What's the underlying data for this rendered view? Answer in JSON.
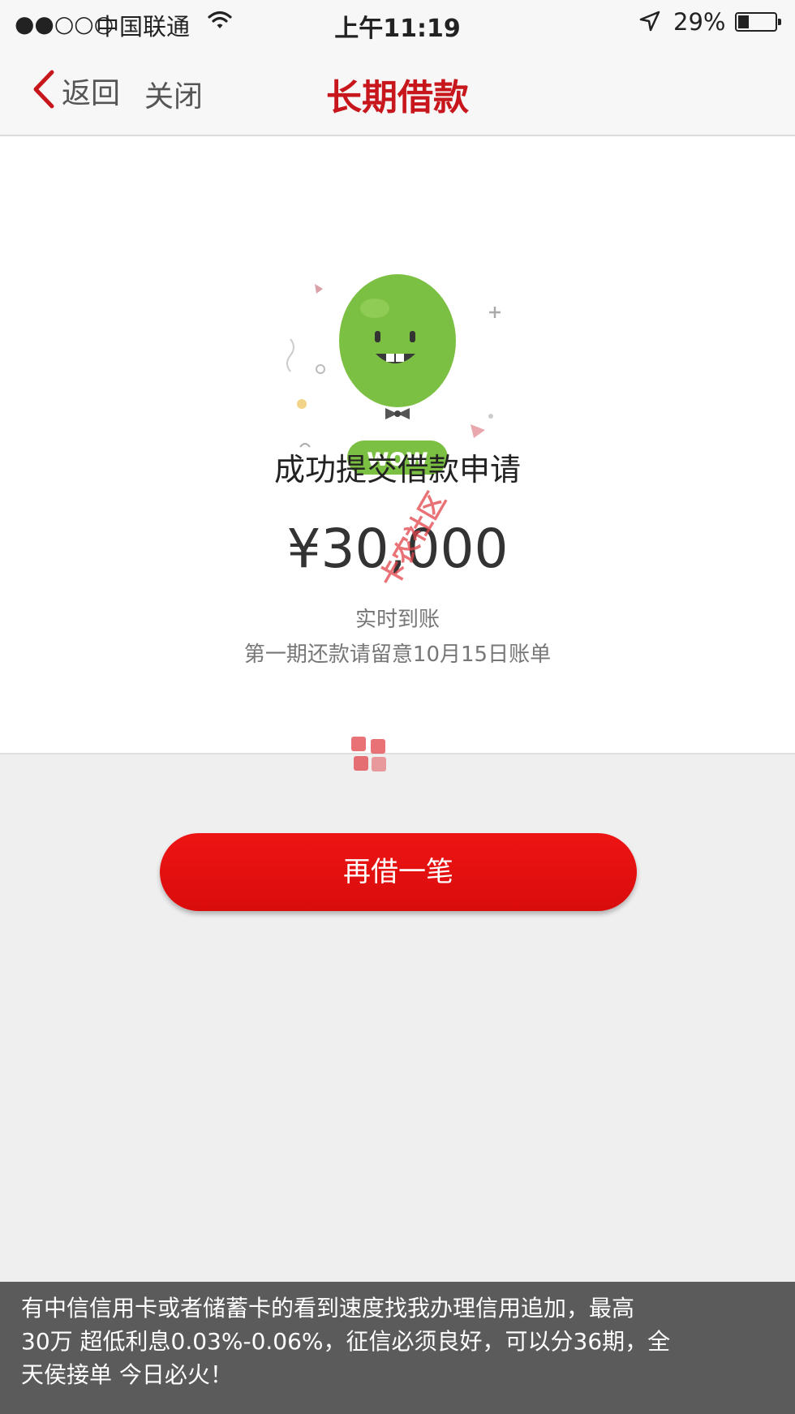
{
  "status_bar": {
    "signal": "●●○○○",
    "carrier": "中国联通",
    "time": "上午11:19",
    "battery_percent": "29%",
    "battery_level": 0.29
  },
  "nav": {
    "back_label": "返回",
    "close_label": "关闭",
    "title": "长期借款",
    "accent_color": "#c8161d"
  },
  "success": {
    "badge_text": "wow",
    "headline": "成功提交借款申请",
    "amount": "¥30,000",
    "arrival_note": "实时到账",
    "repayment_note": "第一期还款请留意10月15日账单"
  },
  "watermark": {
    "text": "卡农社区"
  },
  "actions": {
    "borrow_again_label": "再借一笔"
  },
  "caption": {
    "lines": [
      "有中信信用卡或者储蓄卡的看到速度找我办理信用追加，最高",
      "30万 超低利息0.03%-0.06%，征信必须良好，可以分36期，全",
      "天侯接单 今日必火！"
    ]
  }
}
